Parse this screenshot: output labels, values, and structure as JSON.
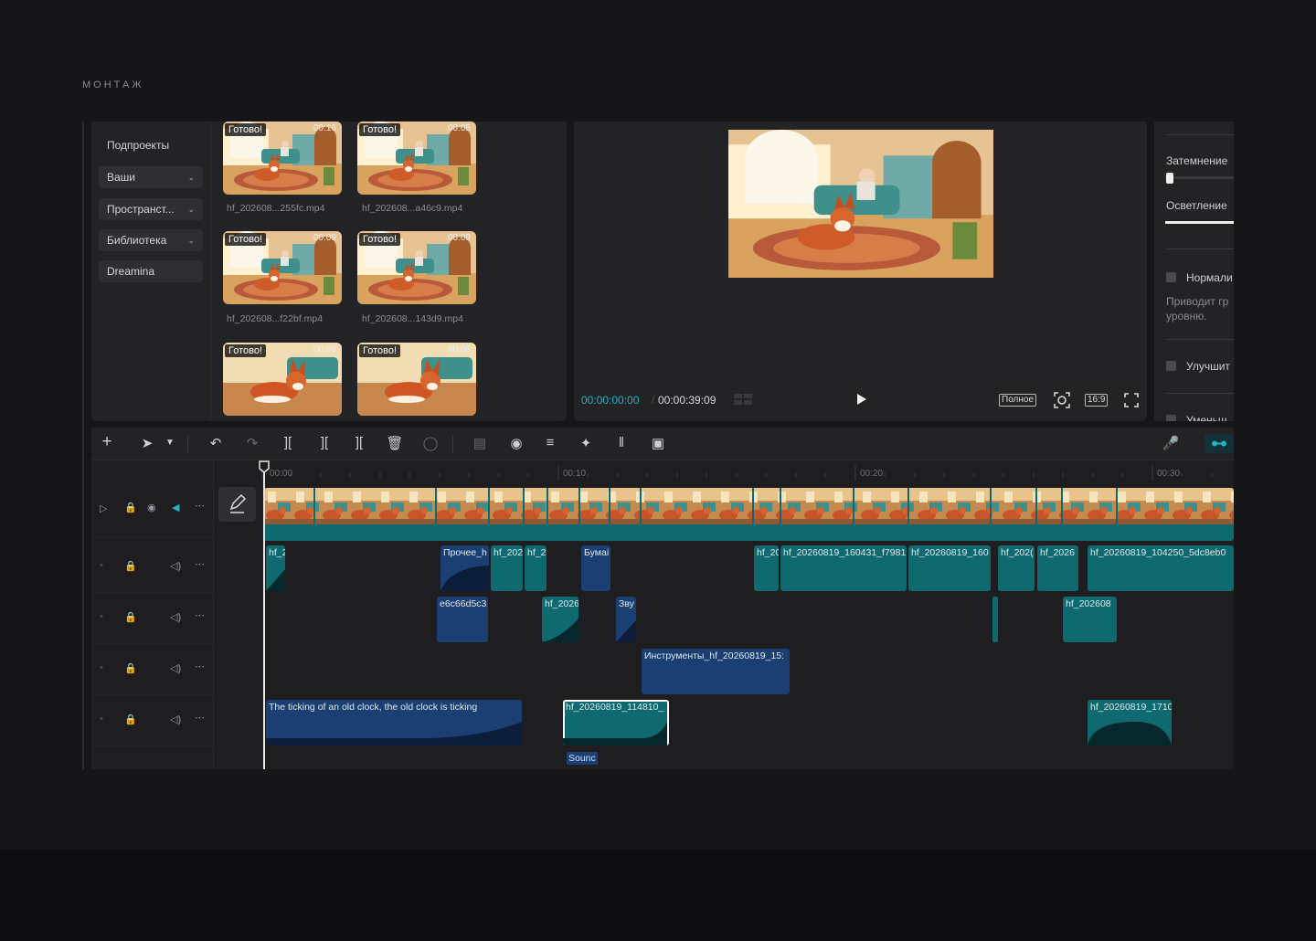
{
  "section_label": "МОНТАЖ",
  "media": {
    "sidebar": {
      "title": "Подпроекты",
      "items": [
        {
          "label": "Ваши",
          "has_dropdown": true
        },
        {
          "label": "Пространст...",
          "has_dropdown": true
        },
        {
          "label": "Библиотека",
          "has_dropdown": true
        },
        {
          "label": "Dreamina",
          "has_dropdown": false
        }
      ]
    },
    "thumbs": [
      {
        "badge": "Готово!",
        "duration": "00:16",
        "name": "hf_202608...255fc.mp4"
      },
      {
        "badge": "Готово!",
        "duration": "00:05",
        "name": "hf_202608...a46c9.mp4"
      },
      {
        "badge": "Готово!",
        "duration": "00:09",
        "name": "hf_202608...f22bf.mp4"
      },
      {
        "badge": "Готово!",
        "duration": "00:09",
        "name": "hf_202608...143d9.mp4"
      },
      {
        "badge": "Готово!",
        "duration": "00:09",
        "name": ""
      },
      {
        "badge": "Готово!",
        "duration": "00:06",
        "name": ""
      }
    ]
  },
  "preview": {
    "current_time": "00:00:00:00",
    "total_time": "00:00:39:09",
    "full_label": "Полное",
    "ratio_label": "16:9"
  },
  "props": {
    "darken_label": "Затемнение",
    "lighten_label": "Осветление",
    "normalize_label": "Нормали",
    "normalize_desc_1": "Приводит гр",
    "normalize_desc_2": "уровню.",
    "enhance_label": "Улучшит",
    "reduce_label": "Уменьш"
  },
  "timeline": {
    "ticks": [
      "00:00",
      "00:10",
      "00:20",
      "00:30"
    ],
    "clips": {
      "a1_1": "hf_2",
      "a1_2": "Прочее_h",
      "a1_3": "hf_202",
      "a1_4": "hf_2",
      "a1_5": "Бумаі",
      "a1_6": "hf_20",
      "a1_7": "hf_20260819_160431_f7981",
      "a1_8": "hf_20260819_160",
      "a1_9": "hf_202(",
      "a1_10": "hf_2026",
      "a1_11": "hf_20260819_104250_5dc8eb0",
      "a2_1": "e6c66d5c3",
      "a2_2": "hf_2026",
      "a2_3": "Зву",
      "a2_4": "hf_202608",
      "a3_1": "Инструменты_hf_20260819_15:",
      "a4_1": "The ticking of an old clock, the old clock is ticking",
      "a4_2": "hf_20260819_114810_",
      "a4_3": "hf_20260819_1710",
      "sound_chip": "Sounc"
    }
  },
  "colors": {
    "accent": "#22b3c4",
    "clip_teal": "#0f6a6f",
    "clip_blue": "#1c3f73"
  }
}
